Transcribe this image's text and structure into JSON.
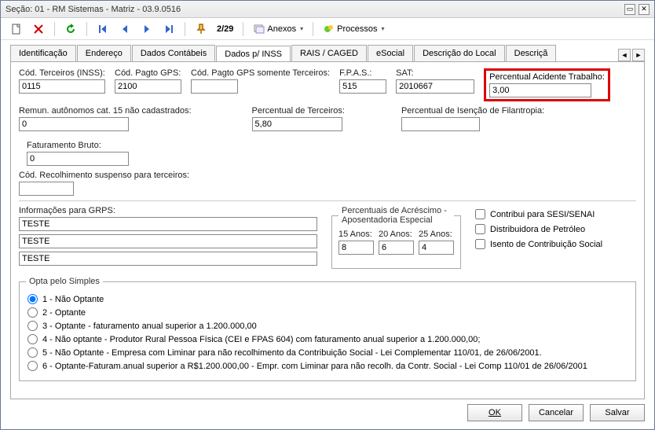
{
  "window": {
    "title": "Seção: 01 - RM Sistemas - Matriz - 03.9.0516"
  },
  "toolbar": {
    "counter": "2/29",
    "anexos": "Anexos",
    "processos": "Processos"
  },
  "tabs": {
    "items": [
      {
        "label": "Identificação"
      },
      {
        "label": "Endereço"
      },
      {
        "label": "Dados Contábeis"
      },
      {
        "label": "Dados p/ INSS"
      },
      {
        "label": "RAIS / CAGED"
      },
      {
        "label": "eSocial"
      },
      {
        "label": "Descrição do Local"
      },
      {
        "label": "Descriçã"
      }
    ],
    "active_index": 3
  },
  "row1": {
    "cod_terceiros": {
      "label": "Cód. Terceiros (INSS):",
      "value": "0115"
    },
    "cod_pagto_gps": {
      "label": "Cód. Pagto GPS:",
      "value": "2100"
    },
    "cod_pagto_gps_terc": {
      "label": "Cód. Pagto GPS somente Terceiros:",
      "value": ""
    },
    "fpas": {
      "label": "F.P.A.S.:",
      "value": "515"
    },
    "sat": {
      "label": "SAT:",
      "value": "2010667"
    },
    "perc_acidente": {
      "label": "Percentual Acidente Trabalho:",
      "value": "3,00"
    }
  },
  "row2": {
    "remun": {
      "label": "Remun. autônomos cat. 15 não cadastrados:",
      "value": "0"
    },
    "perc_terc": {
      "label": "Percentual de Terceiros:",
      "value": "5,80"
    },
    "perc_isencao": {
      "label": "Percentual de Isenção de Filantropia:",
      "value": ""
    },
    "fat_bruto": {
      "label": "Faturamento Bruto:",
      "value": "0"
    }
  },
  "row3": {
    "cod_recolh": {
      "label": "Cód. Recolhimento suspenso para terceiros:",
      "value": ""
    }
  },
  "grps": {
    "label": "Informações para GRPS:",
    "values": [
      "TESTE",
      "TESTE",
      "TESTE"
    ]
  },
  "percentuais": {
    "legend": "Percentuais de Acréscimo - Aposentadoria Especial",
    "anos15": {
      "label": "15 Anos:",
      "value": "8"
    },
    "anos20": {
      "label": "20 Anos:",
      "value": "6"
    },
    "anos25": {
      "label": "25 Anos:",
      "value": "4"
    }
  },
  "checkboxes": {
    "sesi": {
      "label": "Contribui para SESI/SENAI",
      "checked": false
    },
    "petroleo": {
      "label": "Distribuidora de Petróleo",
      "checked": false
    },
    "isento": {
      "label": "Isento de Contribuição Social",
      "checked": false
    }
  },
  "simples": {
    "legend": "Opta pelo Simples",
    "selected_index": 0,
    "options": [
      "1 - Não Optante",
      "2 - Optante",
      "3 - Optante - faturamento anual superior a 1.200.000,00",
      "4 - Não optante - Produtor Rural Pessoa Física (CEI e FPAS 604)  com faturamento anual superior a 1.200.000,00;",
      "5 - Não Optante - Empresa com Liminar para não recolhimento da Contribuição Social - Lei Complementar 110/01, de 26/06/2001.",
      "6 - Optante-Faturam.anual superior a R$1.200.000,00 - Empr. com Liminar para não recolh. da Contr. Social - Lei Comp 110/01 de 26/06/2001"
    ]
  },
  "footer": {
    "ok": "OK",
    "cancelar": "Cancelar",
    "salvar": "Salvar"
  }
}
